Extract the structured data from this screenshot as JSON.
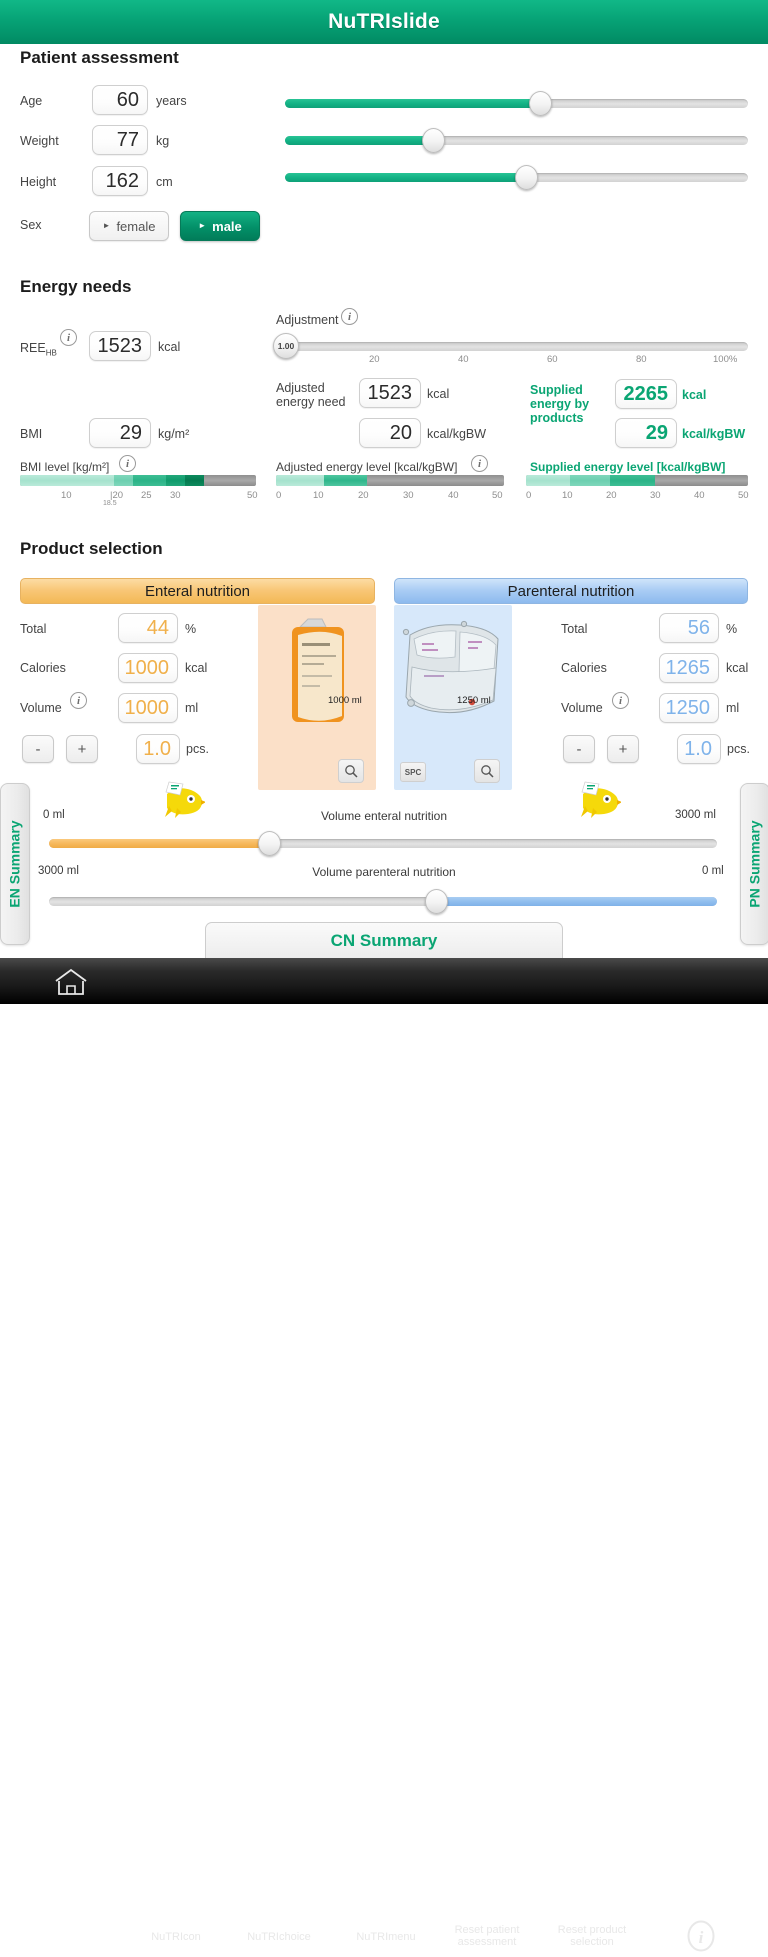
{
  "header": {
    "title": "NuTRIslide"
  },
  "patient": {
    "section_title": "Patient assessment",
    "age": {
      "label": "Age",
      "value": "60",
      "unit": "years",
      "slider_pct": 55
    },
    "weight": {
      "label": "Weight",
      "value": "77",
      "unit": "kg",
      "slider_pct": 32
    },
    "height": {
      "label": "Height",
      "value": "162",
      "unit": "cm",
      "slider_pct": 52
    },
    "sex": {
      "label": "Sex",
      "female": "female",
      "male": "male",
      "selected": "male"
    }
  },
  "energy": {
    "section_title": "Energy needs",
    "ree": {
      "label": "REE",
      "sub": "HB",
      "value": "1523",
      "unit": "kcal",
      "info": "info-icon"
    },
    "adjustment": {
      "label": "Adjustment",
      "handle_value": "1.00",
      "ticks": [
        "20",
        "40",
        "60",
        "80",
        "100%"
      ],
      "slider_pct": 0
    },
    "adjusted_need": {
      "label": "Adjusted energy need",
      "value": "1523",
      "unit": "kcal"
    },
    "adjusted_per_kg": {
      "value": "20",
      "unit": "kcal/kgBW"
    },
    "supplied": {
      "label": "Supplied energy by products",
      "value": "2265",
      "unit": "kcal"
    },
    "supplied_per_kg": {
      "value": "29",
      "unit": "kcal/kgBW"
    },
    "bmi": {
      "label": "BMI",
      "value": "29",
      "unit": "kg/m²"
    },
    "bmi_level": {
      "label": "BMI level [kg/m²]",
      "ticks": [
        "10",
        "20",
        "25",
        "30",
        "50"
      ],
      "sub_tick": "18.5"
    },
    "adjusted_level": {
      "label": "Adjusted energy level [kcal/kgBW]",
      "ticks": [
        "0",
        "10",
        "20",
        "30",
        "40",
        "50"
      ],
      "fill_value": 20
    },
    "supplied_level": {
      "label": "Supplied energy level [kcal/kgBW]",
      "ticks": [
        "0",
        "10",
        "20",
        "30",
        "40",
        "50"
      ],
      "fill_value": 29
    }
  },
  "products": {
    "section_title": "Product selection",
    "enteral": {
      "title": "Enteral nutrition",
      "total": {
        "label": "Total",
        "value": "44",
        "unit": "%"
      },
      "calories": {
        "label": "Calories",
        "value": "1000",
        "unit": "kcal"
      },
      "volume": {
        "label": "Volume",
        "value": "1000",
        "unit": "ml"
      },
      "pieces": {
        "value": "1.0",
        "unit": "pcs."
      },
      "minus": "-",
      "plus": "+",
      "image_caption": "1000 ml",
      "magnifier": "magnifier-icon"
    },
    "parenteral": {
      "title": "Parenteral nutrition",
      "total": {
        "label": "Total",
        "value": "56",
        "unit": "%"
      },
      "calories": {
        "label": "Calories",
        "value": "1265",
        "unit": "kcal"
      },
      "volume": {
        "label": "Volume",
        "value": "1250",
        "unit": "ml"
      },
      "pieces": {
        "value": "1.0",
        "unit": "pcs."
      },
      "minus": "-",
      "plus": "+",
      "image_caption": "1250 ml",
      "spc": "SPC",
      "magnifier": "magnifier-icon"
    }
  },
  "volume_sliders": {
    "enteral": {
      "left": "0 ml",
      "center": "Volume enteral nutrition",
      "right": "3000 ml",
      "slider_pct": 33
    },
    "parenteral": {
      "left": "3000 ml",
      "center": "Volume parenteral nutrition",
      "right": "0 ml",
      "slider_pct": 58
    }
  },
  "side_tabs": {
    "en": "EN Summary",
    "pn": "PN Summary"
  },
  "cn_button": {
    "label": "CN Summary"
  },
  "bottom_bar": {
    "home": "home-icon",
    "items": [
      "NuTRIcon",
      "NuTRIchoice",
      "NuTRImenu"
    ],
    "reset_patient_1": "Reset patient",
    "reset_patient_2": "assessment",
    "reset_product_1": "Reset product",
    "reset_product_2": "selection",
    "info": "info-icon"
  },
  "colors": {
    "brand_green": "#0aa573",
    "enteral_orange": "#f3b956",
    "parenteral_blue": "#8dbaee"
  }
}
